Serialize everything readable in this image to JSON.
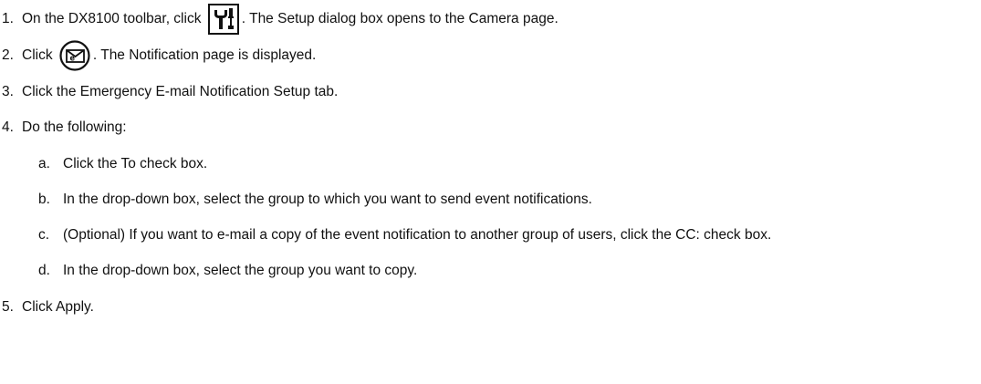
{
  "steps": [
    {
      "number": "1.",
      "before_icon": "On the DX8100 toolbar, click ",
      "icon": "setup-tools-icon",
      "after_icon": ". The Setup dialog box opens to the Camera page."
    },
    {
      "number": "2.",
      "before_icon": "Click ",
      "icon": "email-notification-icon",
      "after_icon": ". The Notification page is displayed."
    },
    {
      "number": "3.",
      "text": "Click the Emergency E-mail Notification Setup tab."
    },
    {
      "number": "4.",
      "text": "Do the following:",
      "substeps": [
        {
          "letter": "a.",
          "text": "Click the To check box."
        },
        {
          "letter": "b.",
          "text": "In the drop-down box, select the group to which you want to send event notifications."
        },
        {
          "letter": "c.",
          "text": "(Optional) If you want to e-mail a copy of the event notification to another group of users, click the CC: check box."
        },
        {
          "letter": "d.",
          "text": "In the drop-down box, select the group you want to copy."
        }
      ]
    },
    {
      "number": "5.",
      "text": "Click Apply."
    }
  ]
}
